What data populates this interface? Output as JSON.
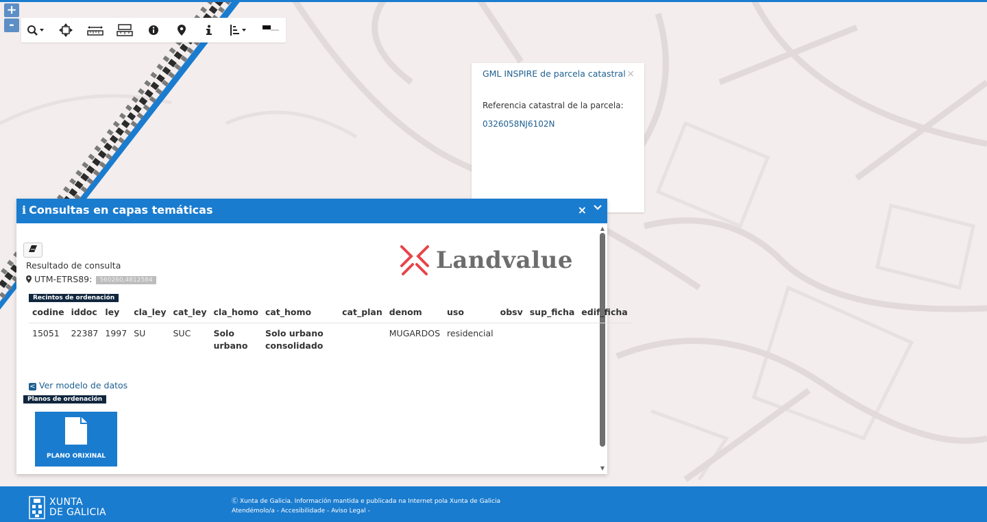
{
  "map": {
    "zoom_in": "+",
    "zoom_out": "-"
  },
  "toolbar": {
    "icons": [
      "search-dropdown-icon",
      "fullscreen-arrows-icon",
      "measure-distance-icon",
      "measure-area-icon",
      "info-circle-icon",
      "location-pin-icon",
      "info-icon",
      "layers-list-dropdown-icon",
      "legend-icon"
    ]
  },
  "gml_popup": {
    "title": "GML INSPIRE de parcela catastral",
    "close": "×",
    "label": "Referencia catastral de la parcela:",
    "reference": "0326058NJ6102N"
  },
  "panel": {
    "icon": "i",
    "title": "Consultas en capas temáticas",
    "close": "×",
    "result_title": "Resultado de consulta",
    "utm_label": "UTM-ETRS89:",
    "utm_value": "560260,4812584",
    "logo_text": "Landvalue",
    "section_recintos": "Recintos de ordenación",
    "columns": [
      "codine",
      "iddoc",
      "ley",
      "cla_ley",
      "cat_ley",
      "cla_homo",
      "cat_homo",
      "cat_plan",
      "denom",
      "uso",
      "obsv",
      "sup_ficha",
      "edif_ficha"
    ],
    "row": {
      "codine": "15051",
      "iddoc": "22387",
      "ley": "1997",
      "cla_ley": "SU",
      "cat_ley": "SUC",
      "cla_homo_1": "Solo",
      "cla_homo_2": "urbano",
      "cat_homo_1": "Solo urbano",
      "cat_homo_2": "consolidado",
      "cat_plan": "",
      "denom": "MUGARDOS",
      "uso": "residencial",
      "obsv": "",
      "sup_ficha": "",
      "edif_ficha": ""
    },
    "ver_modelo": "Ver modelo de datos",
    "section_planos": "Planos de ordenación",
    "plano_label": "PLANO ORIXINAL"
  },
  "footer": {
    "brand_line1": "XUNTA",
    "brand_line2": "DE GALICIA",
    "copyright": "Xunta de Galicia. Información mantida e publicada na Internet pola Xunta de Galicia",
    "links": "Atendémolo/a - Accesibilidade - Aviso Legal -"
  },
  "colors": {
    "accent": "#1a7ccf",
    "link": "#1e6091",
    "tag_bg": "#10263e",
    "map_bg": "#f3eded",
    "logo_red": "#e8434a"
  }
}
